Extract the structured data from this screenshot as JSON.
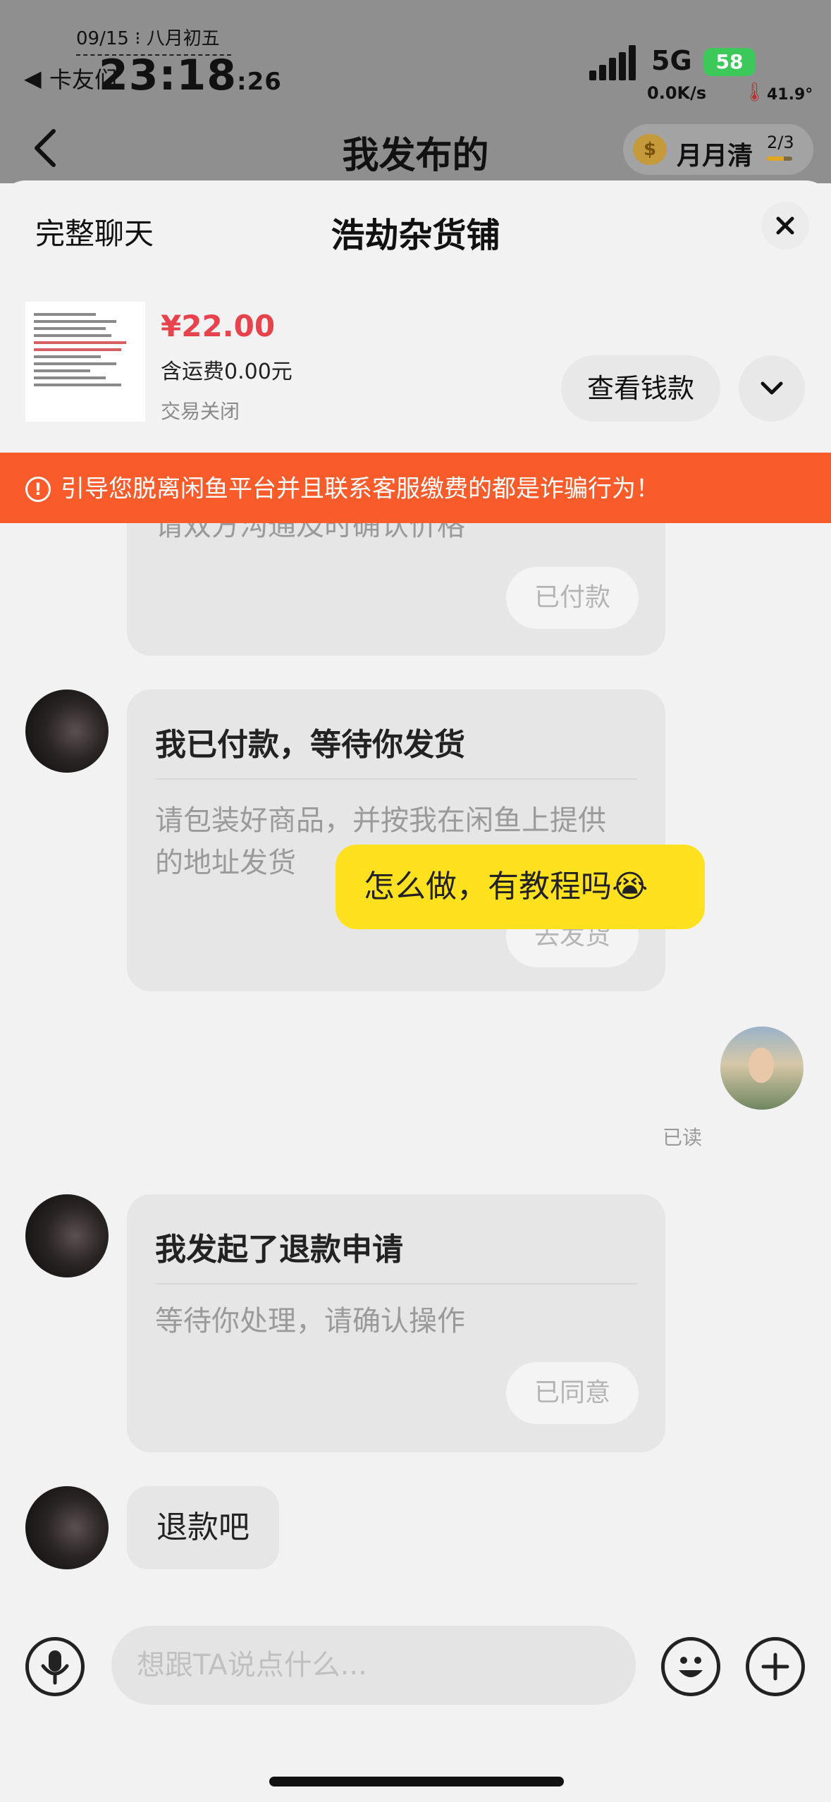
{
  "status_bar": {
    "date": "09/15 ⁝ 八月初五",
    "back_arrow": "◀",
    "carrier": "卡友们",
    "time": "23:18",
    "seconds": ":26",
    "network": "5G",
    "battery": "58",
    "speed": "0.0K/s",
    "temperature": "41.9°"
  },
  "nav": {
    "title": "我发布的",
    "monthly_label": "月月清",
    "monthly_count": "2/3",
    "monthly_progress": 0.67
  },
  "sheet": {
    "full_chat_label": "完整聊天",
    "shop_name": "浩劫杂货铺"
  },
  "product": {
    "price": "¥22.00",
    "shipping": "含运费0.00元",
    "status": "交易关闭",
    "view_payment_label": "查看钱款"
  },
  "warning": {
    "icon": "!",
    "text": "引导您脱离闲鱼平台并且联系客服缴费的都是诈骗行为！"
  },
  "messages": {
    "card1": {
      "partial_text": "请双方沟通及时确认价格",
      "button": "已付款"
    },
    "card2": {
      "title": "我已付款，等待你发货",
      "body": "请包装好商品，并按我在闲鱼上提供的地址发货",
      "button": "去发货"
    },
    "my_message": {
      "text": "怎么做，有教程吗😭",
      "read_status": "已读"
    },
    "card3": {
      "title": "我发起了退款申请",
      "body": "等待你处理，请确认操作",
      "button": "已同意"
    },
    "buyer_text": "退款吧"
  },
  "input": {
    "placeholder": "想跟TA说点什么..."
  },
  "colors": {
    "accent_yellow": "#ffe11f",
    "price_red": "#e8434c",
    "warning_orange": "#fa5b2b",
    "battery_green": "#3dc95a"
  },
  "icons": {
    "back": "chevron-left-icon",
    "close": "close-icon",
    "expand": "chevron-down-icon",
    "voice": "microphone-icon",
    "emoji": "emoji-icon",
    "plus": "plus-icon",
    "coin": "coin-icon"
  }
}
